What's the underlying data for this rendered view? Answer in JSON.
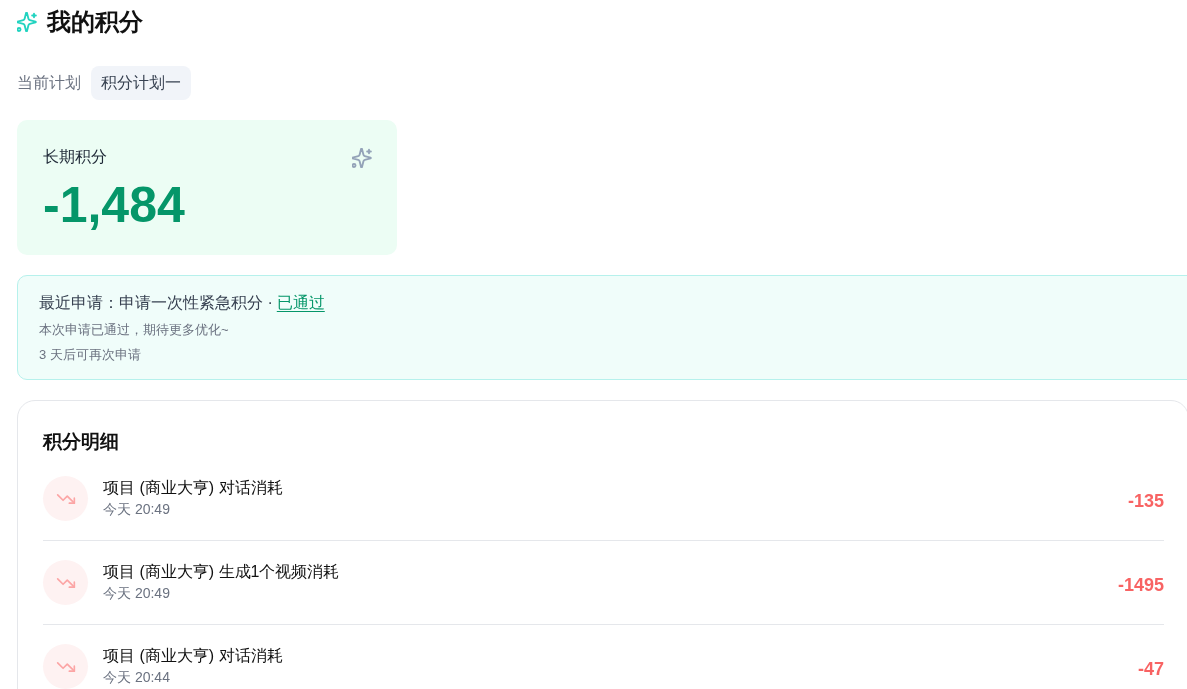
{
  "header": {
    "title": "我的积分"
  },
  "plan": {
    "label": "当前计划",
    "value": "积分计划一"
  },
  "balance": {
    "label": "长期积分",
    "value": "-1,484"
  },
  "notice": {
    "prefix": "最近申请：申请一次性紧急积分 ·",
    "status": {
      "text": "已通过",
      "kind": "approved"
    },
    "message": "本次申请已通过，期待更多优化~",
    "cooldown": "3 天后可再次申请"
  },
  "details": {
    "title": "积分明细",
    "entries": [
      {
        "kind": "expense",
        "title": "项目 (商业大亨) 对话消耗",
        "time": "今天 20:49",
        "amount": "-135"
      },
      {
        "kind": "expense",
        "title": "项目 (商业大亨) 生成1个视频消耗",
        "time": "今天 20:49",
        "amount": "-1495"
      },
      {
        "kind": "expense",
        "title": "项目 (商业大亨) 对话消耗",
        "time": "今天 20:44",
        "amount": "-47"
      }
    ]
  }
}
